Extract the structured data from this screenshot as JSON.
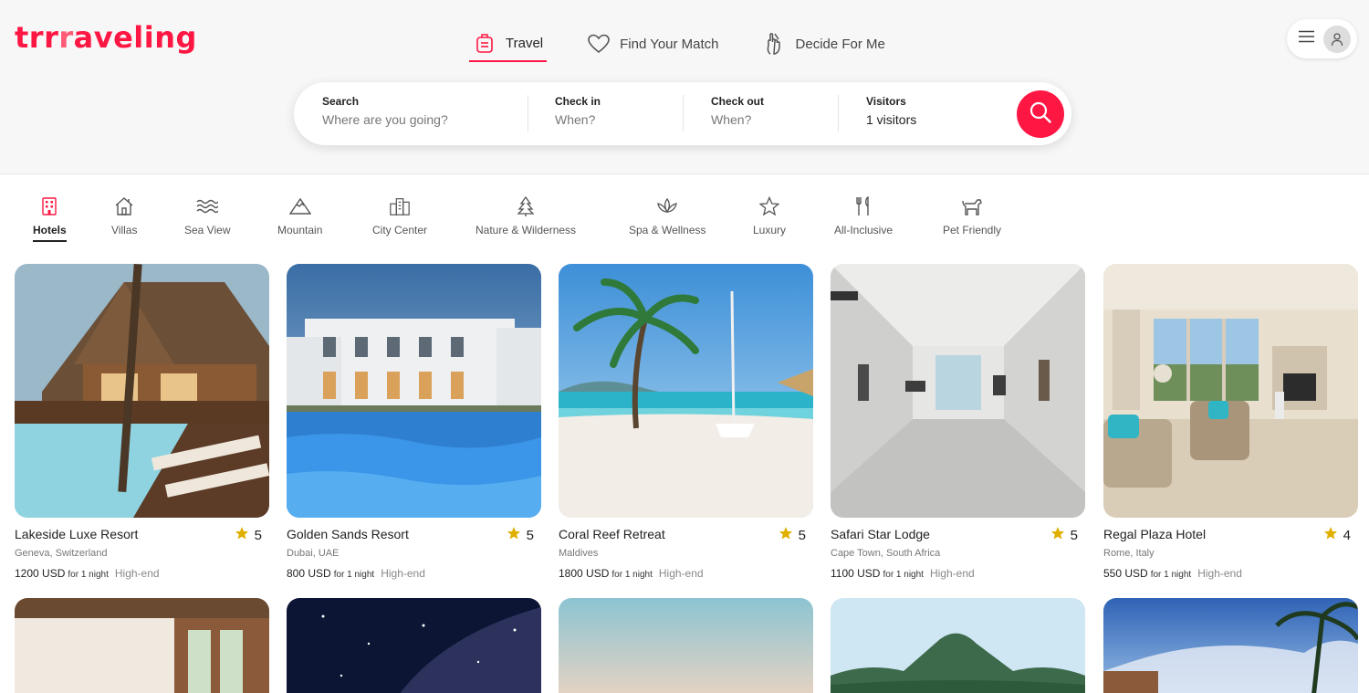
{
  "brand": {
    "logo": [
      "trr",
      "r",
      "aveling"
    ],
    "accent": "#ff1744"
  },
  "topnav": [
    {
      "label": "Travel",
      "icon": "suitcase-icon",
      "active": true
    },
    {
      "label": "Find Your Match",
      "icon": "heart-icon",
      "active": false
    },
    {
      "label": "Decide For Me",
      "icon": "crossed-fingers-icon",
      "active": false
    }
  ],
  "usermenu": {
    "menu_icon": "hamburger-icon",
    "avatar_icon": "user-icon"
  },
  "search": {
    "search_label": "Search",
    "search_placeholder": "Where are you going?",
    "checkin_label": "Check in",
    "checkin_value": "When?",
    "checkout_label": "Check out",
    "checkout_value": "When?",
    "visitors_label": "Visitors",
    "visitors_value": "1 visitors",
    "button_icon": "search-icon"
  },
  "categories": [
    {
      "label": "Hotels",
      "icon": "hotel-icon",
      "active": true
    },
    {
      "label": "Villas",
      "icon": "house-icon",
      "active": false
    },
    {
      "label": "Sea View",
      "icon": "waves-icon",
      "active": false
    },
    {
      "label": "Mountain",
      "icon": "mountain-icon",
      "active": false
    },
    {
      "label": "City Center",
      "icon": "city-icon",
      "active": false
    },
    {
      "label": "Nature & Wilderness",
      "icon": "tree-icon",
      "active": false
    },
    {
      "label": "Spa & Wellness",
      "icon": "lotus-icon",
      "active": false
    },
    {
      "label": "Luxury",
      "icon": "star-icon",
      "active": false
    },
    {
      "label": "All-Inclusive",
      "icon": "cutlery-icon",
      "active": false
    },
    {
      "label": "Pet Friendly",
      "icon": "dog-icon",
      "active": false
    }
  ],
  "listings": [
    {
      "title": "Lakeside Luxe Resort",
      "rating": "5",
      "location": "Geneva, Switzerland",
      "price": "1200 USD",
      "per": "for 1 night",
      "tier": "High-end"
    },
    {
      "title": "Golden Sands Resort",
      "rating": "5",
      "location": "Dubai, UAE",
      "price": "800 USD",
      "per": "for 1 night",
      "tier": "High-end"
    },
    {
      "title": "Coral Reef Retreat",
      "rating": "5",
      "location": "Maldives",
      "price": "1800 USD",
      "per": "for 1 night",
      "tier": "High-end"
    },
    {
      "title": "Safari Star Lodge",
      "rating": "5",
      "location": "Cape Town, South Africa",
      "price": "1100 USD",
      "per": "for 1 night",
      "tier": "High-end"
    },
    {
      "title": "Regal Plaza Hotel",
      "rating": "4",
      "location": "Rome, Italy",
      "price": "550 USD",
      "per": "for 1 night",
      "tier": "High-end"
    }
  ]
}
